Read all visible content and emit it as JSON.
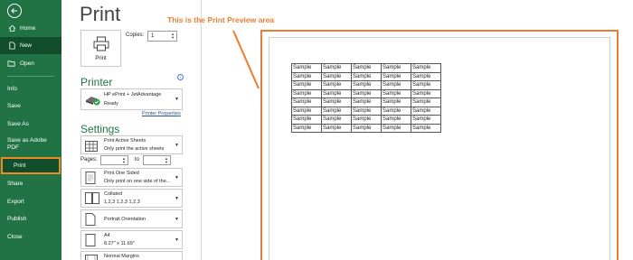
{
  "nav": {
    "items": [
      {
        "label": "Home",
        "icon": "home-icon"
      },
      {
        "label": "New",
        "icon": "new-document-icon"
      },
      {
        "label": "Open",
        "icon": "folder-open-icon"
      },
      {
        "label": "Info"
      },
      {
        "label": "Save"
      },
      {
        "label": "Save As"
      },
      {
        "label": "Save as Adobe PDF"
      },
      {
        "label": "Print"
      },
      {
        "label": "Share"
      },
      {
        "label": "Export"
      },
      {
        "label": "Publish"
      },
      {
        "label": "Close"
      }
    ],
    "active": "New",
    "highlighted": "Print",
    "color": "#217346"
  },
  "page_title": "Print",
  "print_button_label": "Print",
  "copies": {
    "label": "Copies:",
    "value": "1"
  },
  "printer": {
    "section_title": "Printer",
    "name": "HP ePrint + JetAdvantage",
    "status": "Ready",
    "properties_link": "Printer Properties"
  },
  "settings": {
    "section_title": "Settings",
    "sheets": {
      "title": "Print Active Sheets",
      "subtitle": "Only print the active sheets"
    },
    "pages_label": "Pages:",
    "to_label": "to",
    "sided": {
      "title": "Print One Sided",
      "subtitle": "Only print on one side of the..."
    },
    "collated": {
      "title": "Collated",
      "subtitle": "1,2,3    1,2,3    1,2,3"
    },
    "orientation": {
      "title": "Portrait Orientation"
    },
    "paper": {
      "title": "A4",
      "subtitle": "8.27\" x 11.69\""
    },
    "margins": {
      "title": "Normal Margins"
    }
  },
  "preview": {
    "callout": "This is the Print Preview area",
    "accent_color": "#ed7d31",
    "cell_text": "Sample",
    "rows": 8,
    "cols": 5
  }
}
